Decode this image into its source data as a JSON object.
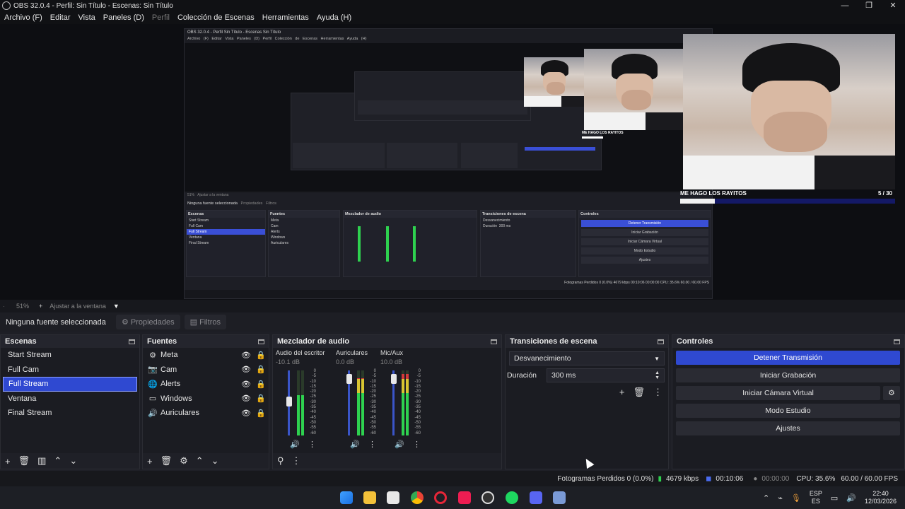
{
  "window": {
    "title": "OBS 32.0.4 - Perfil: Sin Título - Escenas: Sin Título",
    "controls": [
      "—",
      "❐",
      "✕"
    ]
  },
  "menu": {
    "items": [
      "Archivo (F)",
      "Editar",
      "Vista",
      "Paneles (D)",
      "Perfil",
      "Colección de Escenas",
      "Herramientas",
      "Ayuda (H)"
    ]
  },
  "preview": {
    "overlay_text": "ME HAGO LOS RAYITOS",
    "overlay_count": "5 / 30",
    "overlay_progress": 0.16,
    "nested_title": "OBS 32.0.4 - Perfil Sin Título - Escenas Sin Título",
    "nested_menu": "Archivo (F)  Editar  Vista  Paneles (D)  Perfil  Colección de Escenas  Herramientas  Ayuda (H)",
    "nested_overlay_text": "ME HAGO LOS RAYITOS",
    "nested_source_bar": "Ninguna fuente seleccionada",
    "nested_properties": "Propiedades",
    "nested_filters": "Filtros",
    "nested_scenes_header": "Escenas",
    "nested_sources_header": "Fuentes",
    "nested_mixer_header": "Mezclador de audio",
    "nested_transitions_header": "Transiciones de escena",
    "nested_controls_header": "Controles",
    "nested_transition": "Desvanecimiento",
    "nested_duration_label": "Duración",
    "nested_duration_value": "300 ms",
    "nested_zoom_text": "51%",
    "nested_fit_text": "Ajustar a la ventana",
    "nested_status": "Fotogramas Perdidos 0 (0.0%)   4679 kbps   00:10:06   00:00:00   CPU: 35.6%   60.00 / 60.00 FPS"
  },
  "zoom": {
    "value": "51%",
    "plus": "+",
    "fit_label": "Ajustar a la ventana"
  },
  "source_toolbar": {
    "no_source": "Ninguna fuente seleccionada",
    "properties": "Propiedades",
    "filters": "Filtros"
  },
  "scenes": {
    "header": "Escenas",
    "items": [
      "Start Stream",
      "Full Cam",
      "Full Stream",
      "Ventana",
      "Final Stream"
    ],
    "selected": "Full Stream"
  },
  "sources": {
    "header": "Fuentes",
    "items": [
      {
        "name": "Meta",
        "icon": "gear-icon"
      },
      {
        "name": "Cam",
        "icon": "camera-icon"
      },
      {
        "name": "Alerts",
        "icon": "globe-icon"
      },
      {
        "name": "Windows",
        "icon": "monitor-icon"
      },
      {
        "name": "Auriculares",
        "icon": "speaker-icon"
      }
    ]
  },
  "mixer": {
    "header": "Mezclador de audio",
    "channels": [
      {
        "name": "Audio del escritorio",
        "db": "-10.1 dB",
        "level": 0.62,
        "fader": 0.6
      },
      {
        "name": "Auriculares",
        "db": "0.0 dB",
        "level": 0.88,
        "fader": 0.95
      },
      {
        "name": "Mic/Aux",
        "db": "10.0 dB",
        "level": 0.95,
        "fader": 0.95
      }
    ],
    "scale": [
      "0",
      "-5",
      "-10",
      "-15",
      "-20",
      "-25",
      "-30",
      "-35",
      "-40",
      "-45",
      "-50",
      "-55",
      "-60"
    ]
  },
  "transitions": {
    "header": "Transiciones de escena",
    "selected": "Desvanecimiento",
    "duration_label": "Duración",
    "duration_value": "300 ms"
  },
  "controls": {
    "header": "Controles",
    "buttons": [
      "Detener Transmisión",
      "Iniciar Grabación",
      "Iniciar Cámara Virtual",
      "Modo Estudio",
      "Ajustes"
    ]
  },
  "status": {
    "dropped_frames": "Fotogramas Perdidos 0 (0.0%)",
    "bitrate": "4679 kbps",
    "stream_time": "00:10:06",
    "record_time": "00:00:00",
    "cpu": "CPU: 35.6%",
    "fps": "60.00 / 60.00 FPS"
  },
  "taskbar": {
    "lang_top": "ESP",
    "lang_bottom": "ES",
    "time": "22:40",
    "date": "12/03/2026"
  },
  "colors": {
    "accent": "#2f49d1",
    "meter_green": "#2ed14f",
    "meter_yellow": "#d8c531",
    "meter_red": "#d23a3a"
  }
}
